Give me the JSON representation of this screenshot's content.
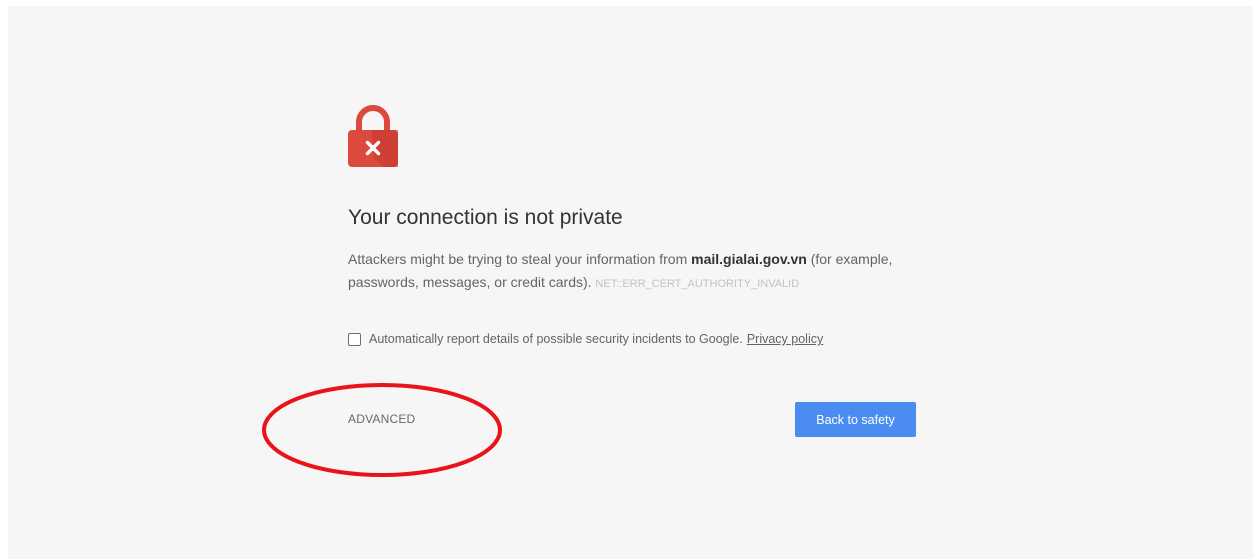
{
  "page": {
    "title": "Your connection is not private",
    "description": {
      "prefix": "Attackers might be trying to steal your information from ",
      "domain": "mail.gialai.gov.vn",
      "suffix": " (for example, passwords, messages, or credit cards). ",
      "error_code": "NET::ERR_CERT_AUTHORITY_INVALID"
    },
    "report": {
      "checked": false,
      "label": "Automatically report details of possible security incidents to Google.",
      "privacy_link": "Privacy policy"
    },
    "advanced_label": "ADVANCED",
    "back_button_label": "Back to safety"
  },
  "icons": {
    "lock": "lock-error-icon"
  },
  "colors": {
    "background": "#f6f6f6",
    "lock_red": "#dc4a3d",
    "primary_button": "#4a8cf0",
    "annotation_circle": "#e8141a"
  }
}
